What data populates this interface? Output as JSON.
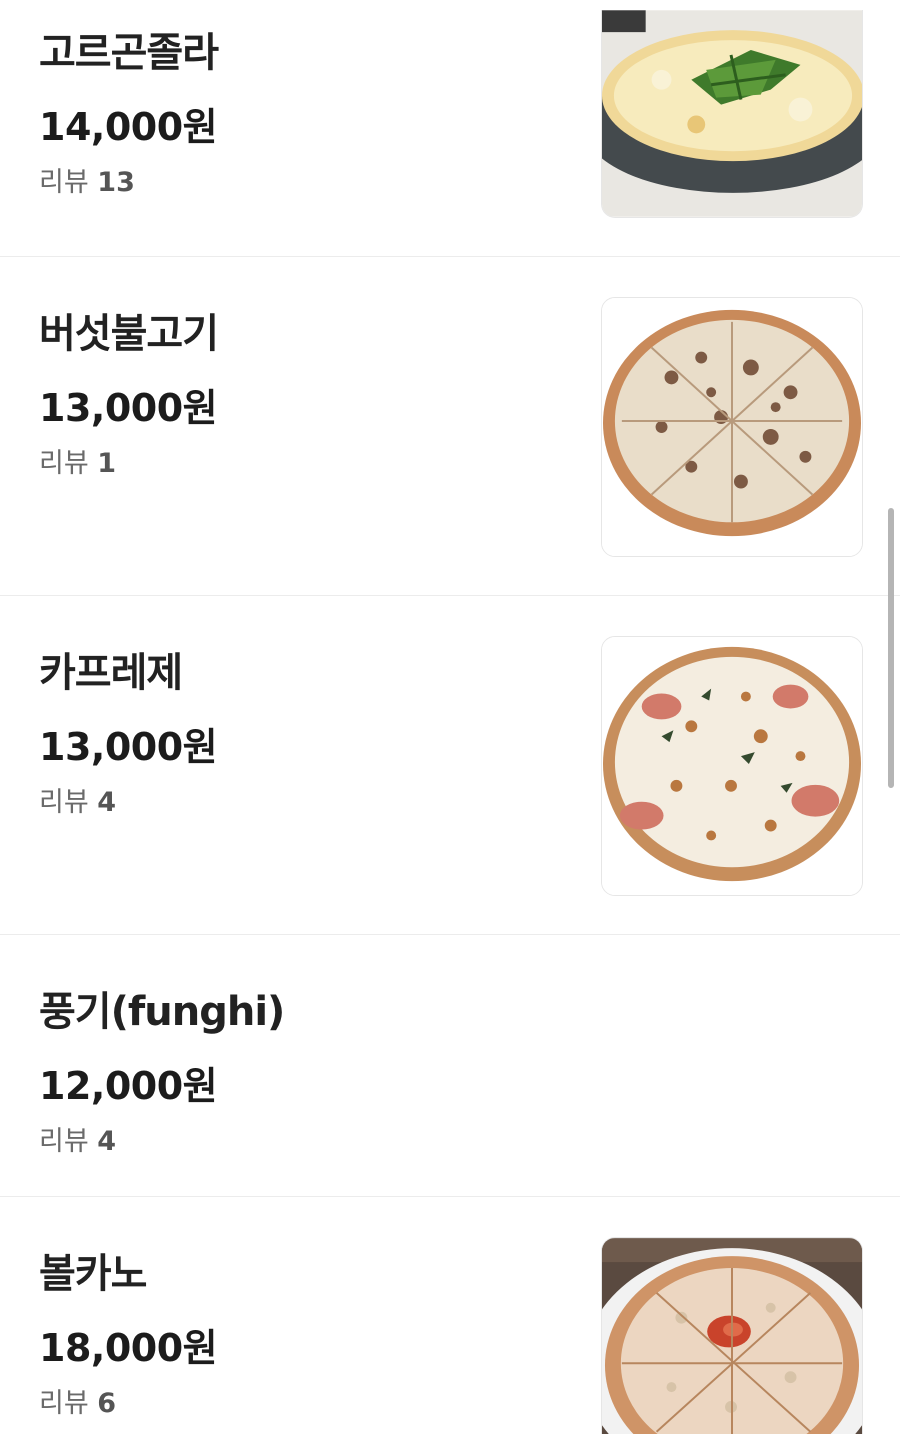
{
  "menu": {
    "review_prefix": "리뷰",
    "items": [
      {
        "name": "고르곤졸라",
        "price": "14,000원",
        "review_count": "13",
        "image": "gorgonzola-pizza-photo"
      },
      {
        "name": "버섯불고기",
        "price": "13,000원",
        "review_count": "1",
        "image": "mushroom-bulgogi-pizza-photo"
      },
      {
        "name": "카프레제",
        "price": "13,000원",
        "review_count": "4",
        "image": "caprese-pizza-photo"
      },
      {
        "name": "풍기(funghi)",
        "price": "12,000원",
        "review_count": "4",
        "image": ""
      },
      {
        "name": "볼카노",
        "price": "18,000원",
        "review_count": "6",
        "image": "volcano-pizza-photo"
      }
    ]
  }
}
